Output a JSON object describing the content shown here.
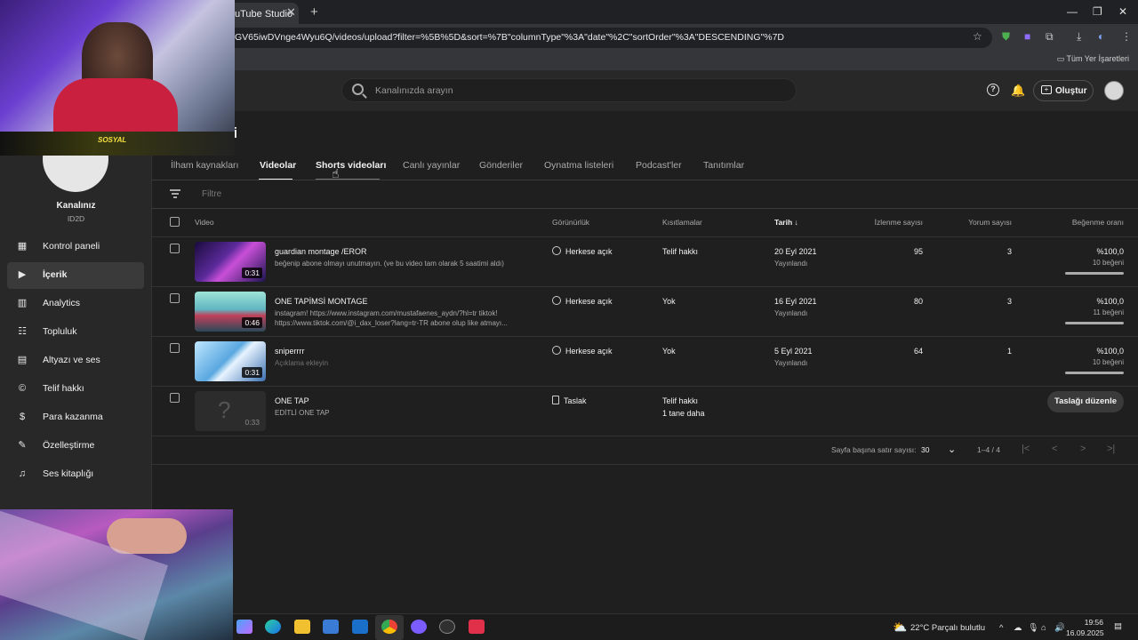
{
  "browser": {
    "tab_title": "uTube Studio",
    "url": "GV65iwDVnge4Wyu6Q/videos/upload?filter=%5B%5D&sort=%7B\"columnType\"%3A\"date\"%2C\"sortOrder\"%3A\"DESCENDING\"%7D",
    "bookmarks_label": "Tüm Yer İşaretleri"
  },
  "header": {
    "search_placeholder": "Kanalınızda arayın",
    "create_label": "Oluştur"
  },
  "channel": {
    "name": "Kanalınız",
    "handle": "ID2D"
  },
  "sidebar": {
    "items": [
      {
        "label": "Kontrol paneli",
        "icon": "dashboard-icon"
      },
      {
        "label": "İçerik",
        "icon": "content-icon",
        "active": true
      },
      {
        "label": "Analytics",
        "icon": "analytics-icon"
      },
      {
        "label": "Topluluk",
        "icon": "community-icon"
      },
      {
        "label": "Altyazı ve ses",
        "icon": "subtitles-icon"
      },
      {
        "label": "Telif hakkı",
        "icon": "copyright-icon"
      },
      {
        "label": "Para kazanma",
        "icon": "dollar-icon"
      },
      {
        "label": "Özelleştirme",
        "icon": "customization-icon"
      },
      {
        "label": "Ses kitaplığı",
        "icon": "audio-library-icon"
      }
    ]
  },
  "main": {
    "title_fragment": "ği",
    "tabs": [
      "İlham kaynakları",
      "Videolar",
      "Shorts videoları",
      "Canlı yayınlar",
      "Gönderiler",
      "Oynatma listeleri",
      "Podcast'ler",
      "Tanıtımlar"
    ],
    "active_tab": "Videolar",
    "filter_placeholder": "Filtre",
    "columns": {
      "video": "Video",
      "visibility": "Görünürlük",
      "restrictions": "Kısıtlamalar",
      "date": "Tarih",
      "views": "İzlenme sayısı",
      "comments": "Yorum sayısı",
      "likes": "Beğenme oranı"
    },
    "rows": [
      {
        "title": "guardian montage /EROR",
        "desc": "beğenip abone olmayı unutmayın. (ve bu video tam olarak 5 saatimi aldı)",
        "duration": "0:31",
        "visibility": "Herkese açık",
        "restriction": "Telif hakkı",
        "date": "20 Eyl 2021",
        "date_sub": "Yayınlandı",
        "views": "95",
        "comments": "3",
        "likes_pct": "%100,0",
        "likes_count": "10 beğeni"
      },
      {
        "title": "ONE TAPİMSİ MONTAGE",
        "desc": "instagram! https://www.instagram.com/mustafaenes_aydn/?hl=tr tiktok! https://www.tiktok.com/@i_dax_loser?lang=tr-TR abone olup like atmayı...",
        "duration": "0:46",
        "visibility": "Herkese açık",
        "restriction": "Yok",
        "date": "16 Eyl 2021",
        "date_sub": "Yayınlandı",
        "views": "80",
        "comments": "3",
        "likes_pct": "%100,0",
        "likes_count": "11 beğeni"
      },
      {
        "title": "sniperrrr",
        "desc": "Açıklama ekleyin",
        "duration": "0:31",
        "visibility": "Herkese açık",
        "restriction": "Yok",
        "date": "5 Eyl 2021",
        "date_sub": "Yayınlandı",
        "views": "64",
        "comments": "1",
        "likes_pct": "%100,0",
        "likes_count": "10 beğeni"
      },
      {
        "title": "ONE TAP",
        "desc": "EDİTLİ ONE TAP",
        "duration": "0:33",
        "visibility": "Taslak",
        "restriction": "Telif hakkı",
        "restriction_more": "1 tane daha",
        "edit_label": "Taslağı düzenle"
      }
    ],
    "pagination": {
      "rows_label": "Sayfa başına satır sayısı:",
      "rows_value": "30",
      "range": "1–4 / 4"
    }
  },
  "taskbar": {
    "weather": "22°C  Parçalı bulutlu",
    "time": "19:56",
    "date": "16.09.2025"
  },
  "overlay": {
    "stream_badge": "SOSYAL"
  },
  "colors": {
    "page_bg": "#1f1f1f",
    "panel_bg": "#282828",
    "text": "#f1f1f1",
    "muted": "#aaaaaa"
  }
}
